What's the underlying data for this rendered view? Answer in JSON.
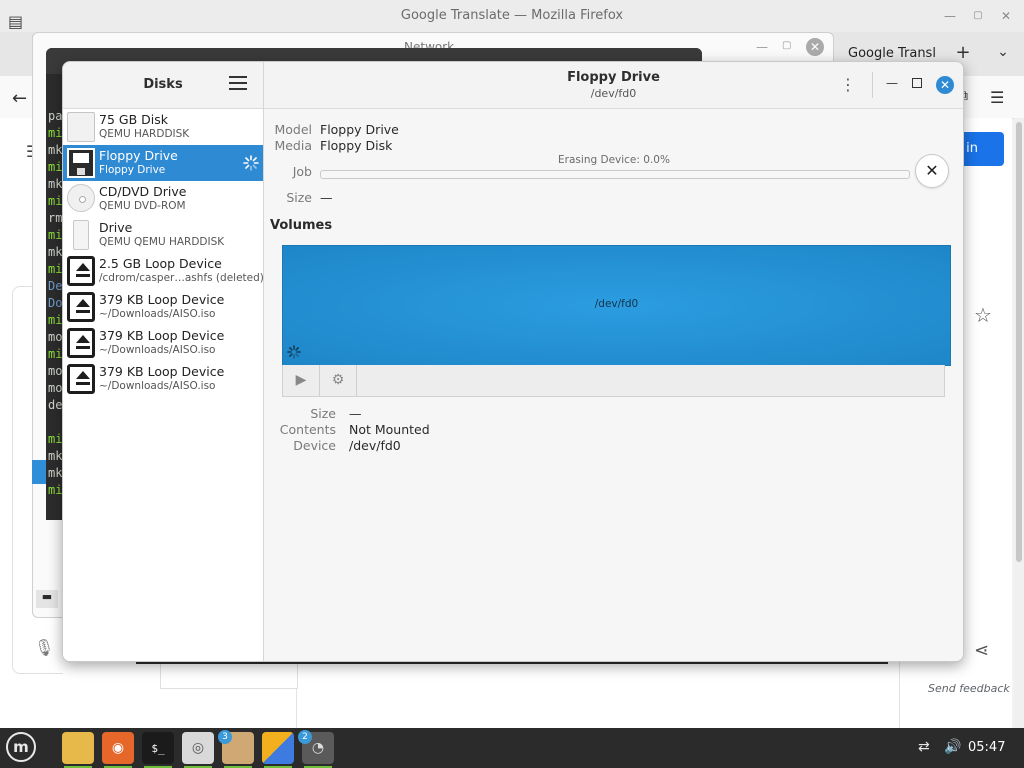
{
  "firefox": {
    "title": "Google Translate — Mozilla Firefox",
    "tab_label": "Google Transl",
    "signin_label": "in",
    "send_feedback": "Send feedback"
  },
  "network_dialog": {
    "title": "Network"
  },
  "terminal": {
    "lines": [
      {
        "text": "pa",
        "color": "white"
      },
      {
        "text": "mi",
        "color": "green"
      },
      {
        "text": "mk",
        "color": "white"
      },
      {
        "text": "mi",
        "color": "green"
      },
      {
        "text": "mk",
        "color": "white"
      },
      {
        "text": "mi",
        "color": "green"
      },
      {
        "text": "rm",
        "color": "white"
      },
      {
        "text": "mi",
        "color": "green"
      },
      {
        "text": "mk",
        "color": "white"
      },
      {
        "text": "mi",
        "color": "green"
      },
      {
        "text": "De",
        "color": "blue"
      },
      {
        "text": "Do",
        "color": "blue"
      },
      {
        "text": "mi",
        "color": "green"
      },
      {
        "text": "mo",
        "color": "white"
      },
      {
        "text": "mi",
        "color": "green"
      },
      {
        "text": "mo",
        "color": "white"
      },
      {
        "text": "mo",
        "color": "white"
      },
      {
        "text": "de",
        "color": "white"
      },
      {
        "text": "",
        "color": "white"
      },
      {
        "text": "mi",
        "color": "green"
      },
      {
        "text": "mk",
        "color": "white"
      },
      {
        "text": "mk",
        "color": "white"
      },
      {
        "text": "mi",
        "color": "green"
      }
    ]
  },
  "disks": {
    "sidebar_title": "Disks",
    "drives": [
      {
        "name": "75 GB Disk",
        "sub": "QEMU HARDDISK",
        "icon": "hdd-icon",
        "selected": false
      },
      {
        "name": "Floppy Drive",
        "sub": "Floppy Drive",
        "icon": "floppy-icon",
        "selected": true
      },
      {
        "name": "CD/DVD Drive",
        "sub": "QEMU DVD-ROM",
        "icon": "optical-disc-icon",
        "selected": false
      },
      {
        "name": "Drive",
        "sub": "QEMU QEMU HARDDISK",
        "icon": "usb-drive-icon",
        "selected": false
      },
      {
        "name": "2.5 GB Loop Device",
        "sub": "/cdrom/casper…ashfs (deleted)",
        "icon": "loop-device-icon",
        "selected": false
      },
      {
        "name": "379 KB Loop Device",
        "sub": "~/Downloads/AISO.iso",
        "icon": "loop-device-icon",
        "selected": false
      },
      {
        "name": "379 KB Loop Device",
        "sub": "~/Downloads/AISO.iso",
        "icon": "loop-device-icon",
        "selected": false
      },
      {
        "name": "379 KB Loop Device",
        "sub": "~/Downloads/AISO.iso",
        "icon": "loop-device-icon",
        "selected": false
      }
    ],
    "header": {
      "title": "Floppy Drive",
      "subtitle": "/dev/fd0"
    },
    "props": {
      "model_label": "Model",
      "model_value": "Floppy Drive",
      "media_label": "Media",
      "media_value": "Floppy Disk",
      "job_label": "Job",
      "job_text": "Erasing Device: 0.0%",
      "job_progress": 0.0,
      "size_label": "Size",
      "size_value": "—"
    },
    "volumes": {
      "heading": "Volumes",
      "map_label": "/dev/fd0",
      "size_label": "Size",
      "size_value": "—",
      "contents_label": "Contents",
      "contents_value": "Not Mounted",
      "device_label": "Device",
      "device_value": "/dev/fd0"
    }
  },
  "taskbar": {
    "apps": [
      {
        "name": "files-icon",
        "badge": ""
      },
      {
        "name": "firefox-icon",
        "badge": ""
      },
      {
        "name": "terminal-icon",
        "badge": ""
      },
      {
        "name": "disc-icon",
        "badge": ""
      },
      {
        "name": "archive-icon",
        "badge": "3"
      },
      {
        "name": "paint-icon",
        "badge": ""
      },
      {
        "name": "disks-icon",
        "badge": "2"
      }
    ],
    "terminal_prompt": "$_",
    "clock": "05:47"
  },
  "colors": {
    "accent": "#2f8ad4",
    "taskbar": "#2b2b2b",
    "terminal_green": "#8ae234"
  }
}
